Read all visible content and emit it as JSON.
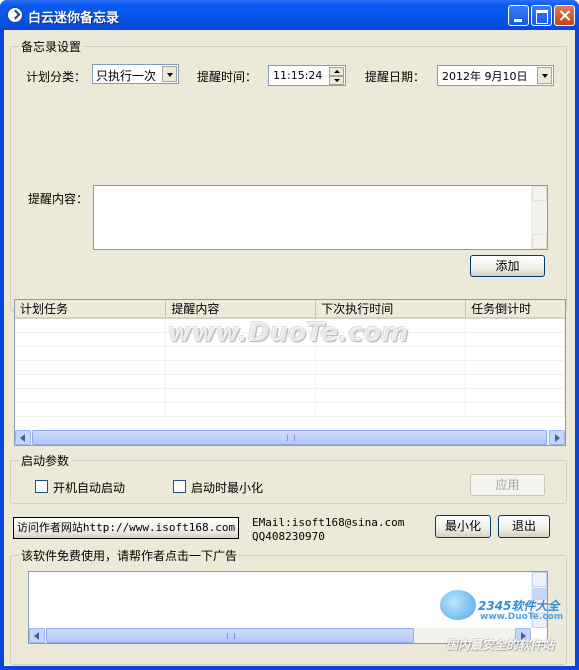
{
  "window": {
    "title": "白云迷你备忘录"
  },
  "settings": {
    "group_title": "备忘录设置",
    "category_label": "计划分类：",
    "category_value": "只执行一次",
    "time_label": "提醒时间：",
    "time_value": "11:15:24",
    "date_label": "提醒日期：",
    "date_value": "2012年 9月10日",
    "content_label": "提醒内容：",
    "content_value": "",
    "add_button": "添加"
  },
  "task_list": {
    "columns": [
      "计划任务",
      "提醒内容",
      "下次执行时间",
      "任务倒计时"
    ],
    "rows": []
  },
  "startup": {
    "group_title": "启动参数",
    "autostart_label": "开机自动启动",
    "minimized_label": "启动时最小化",
    "apply_button": "应用"
  },
  "footer": {
    "website_button": "访问作者网站http://www.isoft168.com",
    "email": "EMail:isoft168@sina.com",
    "qq": "QQ408230970",
    "minimize_button": "最小化",
    "exit_button": "退出"
  },
  "ad": {
    "group_title": "该软件免费使用，请帮作者点击一下广告"
  },
  "watermarks": {
    "duote": "www.DuoTe.com",
    "brand": "2345软件大全",
    "brand_url": "www.DuoTe.com",
    "slogan": "国内最安全的软件站"
  },
  "colors": {
    "titlebar": "#0454e6",
    "client_bg": "#ece9d8",
    "button_border": "#003c74"
  }
}
